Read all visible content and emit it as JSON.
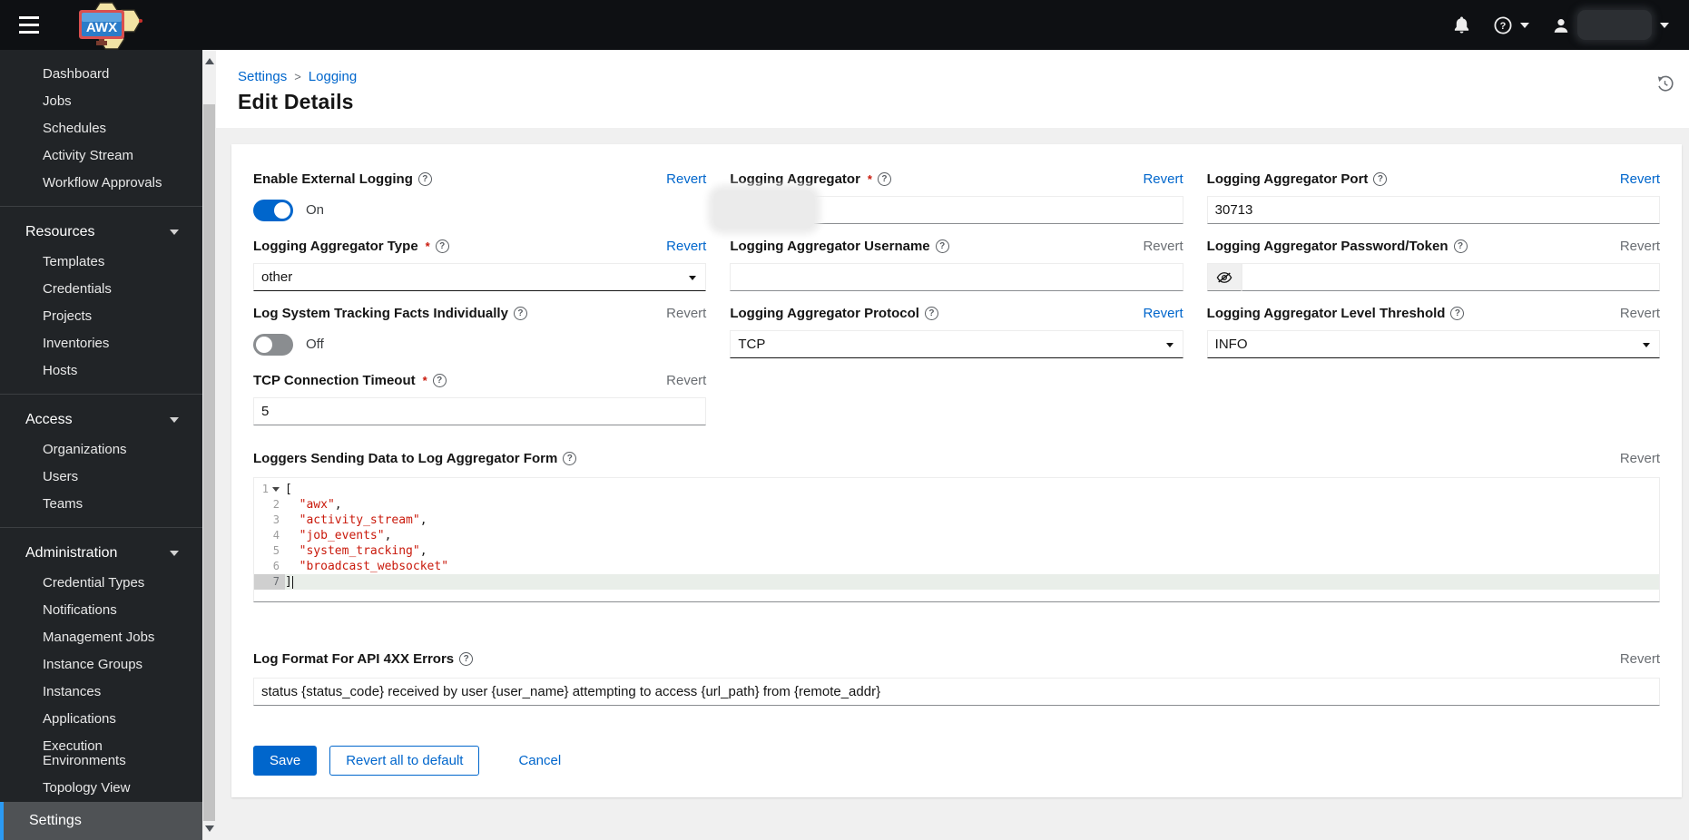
{
  "masthead": {
    "product": "AWX",
    "icons": [
      "hamburger-icon",
      "bell-icon",
      "question-circle-icon",
      "user-icon",
      "caret-down-icon"
    ]
  },
  "breadcrumb": {
    "separator": ">",
    "items": [
      {
        "label": "Settings"
      },
      {
        "label": "Logging"
      }
    ]
  },
  "page": {
    "title": "Edit Details"
  },
  "sidebar": {
    "sections": [
      {
        "header": null,
        "items": [
          "Dashboard",
          "Jobs",
          "Schedules",
          "Activity Stream",
          "Workflow Approvals"
        ]
      },
      {
        "header": "Resources",
        "items": [
          "Templates",
          "Credentials",
          "Projects",
          "Inventories",
          "Hosts"
        ]
      },
      {
        "header": "Access",
        "items": [
          "Organizations",
          "Users",
          "Teams"
        ]
      },
      {
        "header": "Administration",
        "items": [
          "Credential Types",
          "Notifications",
          "Management Jobs",
          "Instance Groups",
          "Instances",
          "Applications",
          "Execution Environments",
          "Topology View"
        ]
      }
    ],
    "footer_item": {
      "label": "Settings",
      "selected": true
    }
  },
  "form": {
    "revert_label": "Revert",
    "fields": {
      "enable_external_logging": {
        "label": "Enable External Logging",
        "value": "On",
        "revert_enabled": true
      },
      "logging_aggregator": {
        "label": "Logging Aggregator",
        "required": "*",
        "value": "",
        "redacted": true,
        "revert_enabled": true
      },
      "logging_aggregator_port": {
        "label": "Logging Aggregator Port",
        "value": "30713",
        "revert_enabled": true
      },
      "logging_aggregator_type": {
        "label": "Logging Aggregator Type",
        "required": "*",
        "value": "other",
        "revert_enabled": true
      },
      "logging_aggregator_username": {
        "label": "Logging Aggregator Username",
        "value": "",
        "revert_enabled": false
      },
      "logging_aggregator_password": {
        "label": "Logging Aggregator Password/Token",
        "value": "",
        "revert_enabled": false
      },
      "log_system_tracking_facts_individually": {
        "label": "Log System Tracking Facts Individually",
        "value": "Off",
        "revert_enabled": false
      },
      "logging_aggregator_protocol": {
        "label": "Logging Aggregator Protocol",
        "value": "TCP",
        "revert_enabled": true
      },
      "logging_aggregator_level_threshold": {
        "label": "Logging Aggregator Level Threshold",
        "value": "INFO",
        "revert_enabled": false
      },
      "tcp_connection_timeout": {
        "label": "TCP Connection Timeout",
        "required": "*",
        "value": "5",
        "revert_enabled": false
      },
      "loggers_form": {
        "label": "Loggers Sending Data to Log Aggregator Form",
        "revert_enabled": false
      },
      "log_format_4xx": {
        "label": "Log Format For API 4XX Errors",
        "value": "status {status_code} received by user {user_name} attempting to access {url_path} from {remote_addr}",
        "revert_enabled": false
      }
    },
    "editor": {
      "lines": [
        "[",
        "  \"awx\",",
        "  \"activity_stream\",",
        "  \"job_events\",",
        "  \"system_tracking\",",
        "  \"broadcast_websocket\"",
        "]"
      ],
      "active_line": 7
    },
    "actions": {
      "save": "Save",
      "revert_all": "Revert all to default",
      "cancel": "Cancel"
    }
  },
  "colors": {
    "accent": "#0066cc",
    "link": "#0066cc",
    "revert_disabled": "#6a6e73",
    "code_string": "#c9190b",
    "nav_selected_bg": "#4f5255",
    "nav_selected_border": "#2b9af3",
    "masthead_bg": "#0e1013",
    "sidebar_bg": "#212427"
  }
}
